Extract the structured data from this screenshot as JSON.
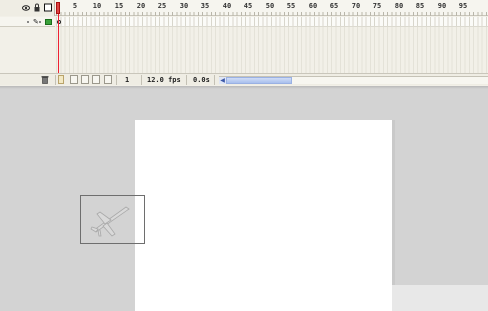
{
  "timeline": {
    "ruler_ticks": [
      "1",
      "5",
      "10",
      "15",
      "20",
      "25",
      "30",
      "35",
      "40",
      "45",
      "50",
      "55",
      "60",
      "65",
      "70",
      "75",
      "80",
      "85",
      "90",
      "95"
    ],
    "header_icons": [
      "eye-icon",
      "lock-icon",
      "outline-icon"
    ],
    "layer": {
      "edit_icon": "pencil-icon",
      "color": "#3aa13a"
    },
    "status": {
      "current_frame": "1",
      "frame_rate": "12.0 fps",
      "elapsed_time": "0.0s"
    }
  },
  "colors": {
    "playhead": "#e02233",
    "scroll_thumb": "#a9c0ee",
    "stage": "#ffffff",
    "pasteboard": "#d3d3d3"
  },
  "stage": {
    "selected_object": "plane-symbol"
  }
}
